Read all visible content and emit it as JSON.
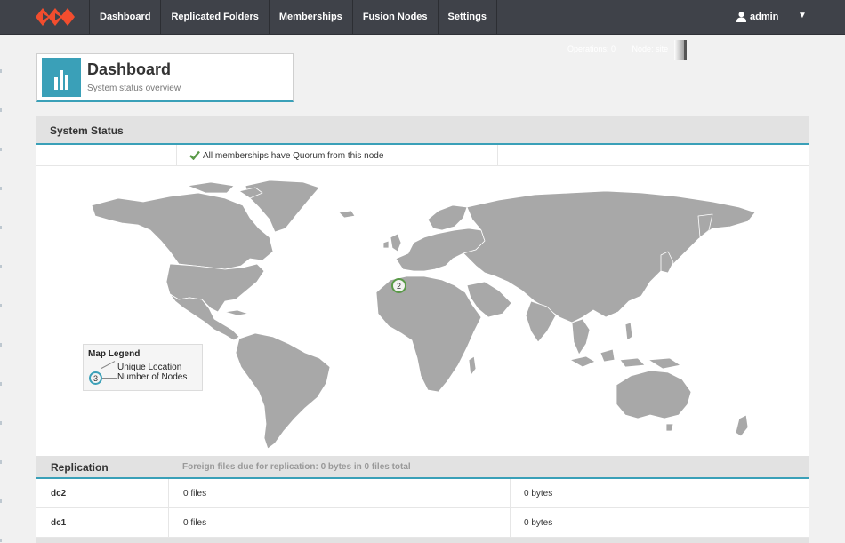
{
  "nav": {
    "items": [
      "Dashboard",
      "Replicated Folders",
      "Memberships",
      "Fusion Nodes",
      "Settings"
    ],
    "user": "admin",
    "caret": "▼"
  },
  "topstatus": {
    "operations": "Operations: 0",
    "node": "Node: site"
  },
  "header": {
    "title": "Dashboard",
    "subtitle": "System status overview"
  },
  "system_status": {
    "title": "System Status",
    "quorum_message": "All memberships have Quorum from this node"
  },
  "map": {
    "cluster_count": "2",
    "legend": {
      "title": "Map Legend",
      "unique_location": "Unique Location",
      "number_of_nodes": "Number of Nodes",
      "sample_count": "3"
    }
  },
  "replication": {
    "title": "Replication",
    "note": "Foreign files due for replication: 0 bytes in 0 files total",
    "rows": [
      {
        "name": "dc2",
        "files": "0 files",
        "bytes": "0 bytes"
      },
      {
        "name": "dc1",
        "files": "0 files",
        "bytes": "0 bytes"
      }
    ]
  },
  "colors": {
    "nav_bg": "#3f4249",
    "accent": "#3aa0b8",
    "brand": "#f24d2e",
    "land": "#a8a8a8",
    "check": "#5a9a48"
  }
}
